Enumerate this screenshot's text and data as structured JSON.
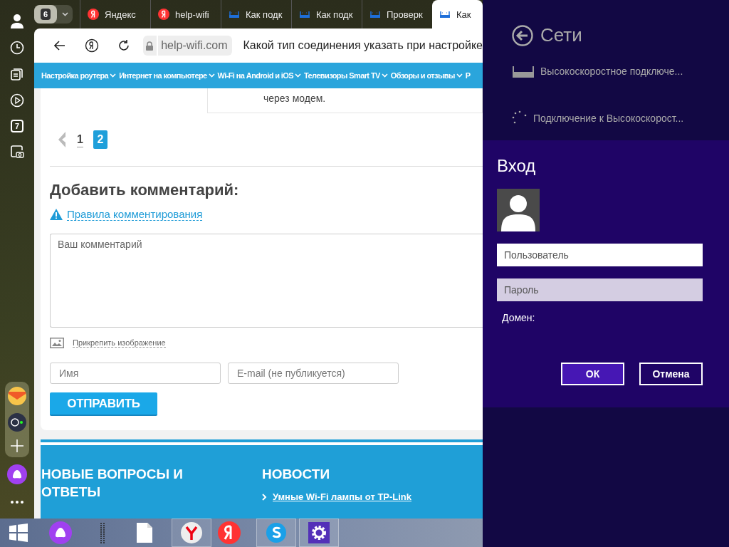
{
  "sidebar": {
    "calendar_day": "7"
  },
  "tabstrip": {
    "tab_count": "6",
    "tabs": [
      {
        "title": "Яндекс",
        "kind": "yandex",
        "selected": false
      },
      {
        "title": "help-wifi",
        "kind": "yandex",
        "selected": false
      },
      {
        "title": "Как подк",
        "kind": "router",
        "selected": false
      },
      {
        "title": "Как подк",
        "kind": "router",
        "selected": false
      },
      {
        "title": "Проверк",
        "kind": "router",
        "selected": false
      },
      {
        "title": "Как",
        "kind": "router",
        "selected": true
      }
    ]
  },
  "address_bar": {
    "domain": "help-wifi.com",
    "page_title": "Какой тип соединения указать при настройке"
  },
  "nav": {
    "items": [
      "Настройка роутера",
      "Интернет на компьютере",
      "Wi-Fi на Android и iOS",
      "Телевизоры Smart TV",
      "Обзоры и отзывы",
      "Р"
    ]
  },
  "article": {
    "text_end": "через модем."
  },
  "pagination": {
    "pages": [
      {
        "label": "1",
        "selected": false
      },
      {
        "label": "2",
        "selected": true
      }
    ]
  },
  "comment_form": {
    "heading": "Добавить комментарий:",
    "rules_link": "Правила комментирования",
    "comment_placeholder": "Ваш комментарий",
    "attach_link": "Прикрепить изображение",
    "name_placeholder": "Имя",
    "email_placeholder": "E-mail (не публикуется)",
    "submit": "ОТПРАВИТЬ"
  },
  "footer": {
    "columns": [
      {
        "heading": "НОВЫЕ ВОПРОСЫ И ОТВЕТЫ"
      },
      {
        "heading": "НОВОСТИ",
        "link": "Умные Wi-Fi лампы от TP-Link"
      }
    ]
  },
  "taskbar": {
    "items": [
      {
        "kind": "start",
        "running": false
      },
      {
        "kind": "alice",
        "running": false
      },
      {
        "kind": "grip",
        "running": false
      },
      {
        "kind": "file",
        "running": false
      },
      {
        "kind": "browser",
        "running": true
      },
      {
        "kind": "yandex",
        "running": false
      },
      {
        "kind": "skype",
        "running": true
      },
      {
        "kind": "settings",
        "running": true
      }
    ]
  },
  "networks_panel": {
    "title": "Сети",
    "networks": [
      {
        "kind": "wired",
        "name": "Высокоскоростное подключе..."
      },
      {
        "kind": "connecting",
        "name": "Подключение к Высокоскорост..."
      }
    ]
  },
  "login_dialog": {
    "title": "Вход",
    "username_placeholder": "Пользователь",
    "password_placeholder": "Пароль",
    "domain_label": "Домен:",
    "buttons": [
      {
        "label": "ОК",
        "primary": true
      },
      {
        "label": "Отмена",
        "primary": false
      }
    ]
  }
}
